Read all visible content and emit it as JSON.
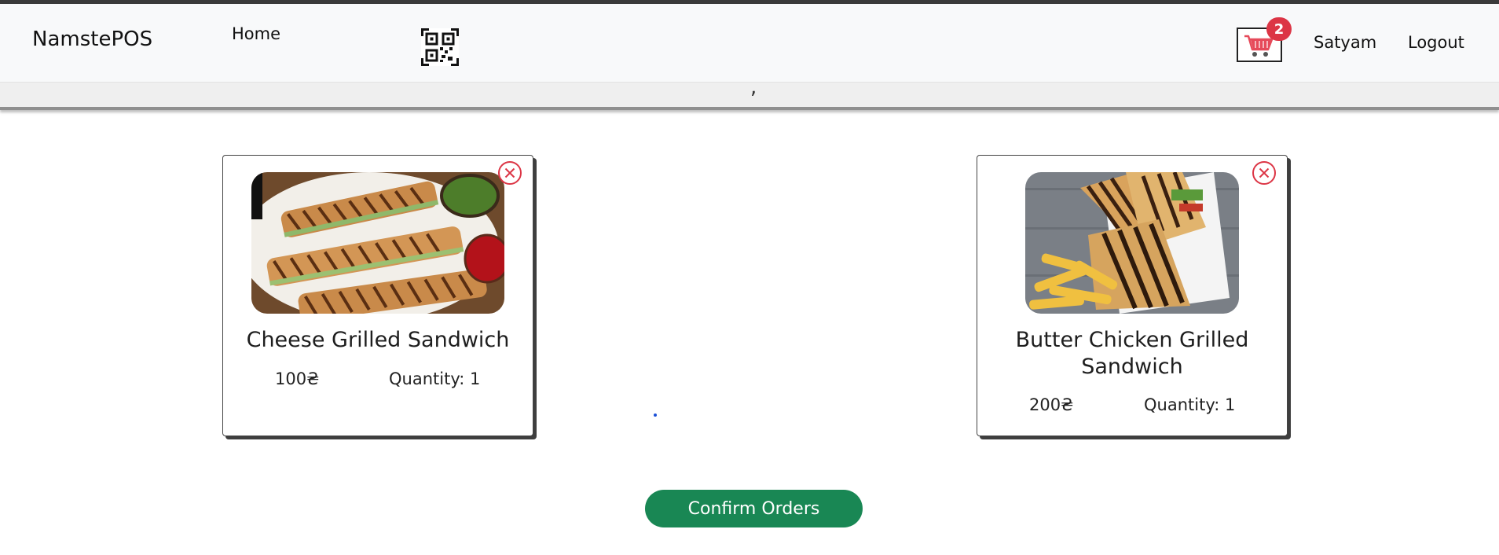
{
  "navbar": {
    "brand": "NamstePOS",
    "home_label": "Home",
    "cart_count": "2",
    "user_label": "Satyam",
    "logout_label": "Logout"
  },
  "cart_items": [
    {
      "name": "Cheese Grilled Sandwich",
      "price": "100₴",
      "quantity": "Quantity: 1"
    },
    {
      "name": "Butter Chicken Grilled Sandwich",
      "price": "200₴",
      "quantity": "Quantity: 1"
    }
  ],
  "confirm_label": "Confirm Orders",
  "colors": {
    "accent_green": "#198754",
    "badge_red": "#dc3545",
    "remove_red": "#dc3545"
  },
  "icons": {
    "qr": "qr-code-icon",
    "cart": "shopping-cart-icon",
    "remove": "remove-circle-icon"
  }
}
